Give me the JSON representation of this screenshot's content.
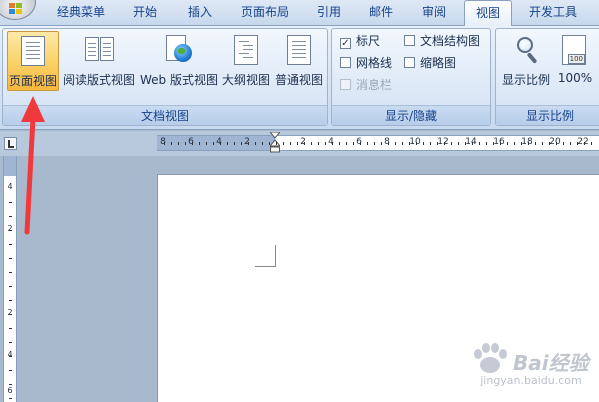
{
  "tabs": [
    {
      "label": "经典菜单"
    },
    {
      "label": "开始"
    },
    {
      "label": "插入"
    },
    {
      "label": "页面布局"
    },
    {
      "label": "引用"
    },
    {
      "label": "邮件"
    },
    {
      "label": "审阅"
    },
    {
      "label": "视图"
    },
    {
      "label": "开发工具"
    }
  ],
  "ribbon": {
    "views_group": {
      "label": "文档视图",
      "buttons": [
        {
          "label": "页面视图"
        },
        {
          "label": "阅读版式视图"
        },
        {
          "label": "Web 版式视图"
        },
        {
          "label": "大纲视图"
        },
        {
          "label": "普通视图"
        }
      ]
    },
    "show_group": {
      "label": "显示/隐藏",
      "items": [
        {
          "label": "标尺",
          "checked": true
        },
        {
          "label": "文档结构图",
          "checked": false
        },
        {
          "label": "网格线",
          "checked": false
        },
        {
          "label": "缩略图",
          "checked": false
        },
        {
          "label": "消息栏",
          "checked": false
        }
      ]
    },
    "zoom_group": {
      "label": "显示比例",
      "buttons": [
        {
          "label": "显示比例"
        },
        {
          "label": "100%"
        }
      ],
      "zoom_icon_text": "100"
    }
  },
  "hruler": {
    "left_numbers": [
      "8",
      "6",
      "4",
      "2"
    ],
    "right_numbers": [
      "2",
      "4",
      "6",
      "8",
      "10",
      "12",
      "14",
      "16",
      "18",
      "20",
      "22"
    ]
  },
  "vruler": {
    "numbers": [
      "4",
      "2",
      "2",
      "4",
      "6"
    ]
  },
  "watermark": {
    "brand": "Bai经验",
    "url": "jingyan.baidu.com"
  },
  "colors": {
    "accent": "#15428b",
    "selected_bg": "#fbd36a",
    "arrow": "#f0393d"
  }
}
